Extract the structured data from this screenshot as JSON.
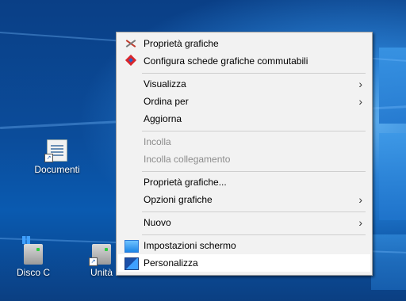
{
  "desktop": {
    "icons": [
      {
        "label": "Documenti"
      },
      {
        "label": "Disco C"
      },
      {
        "label": "Unità"
      }
    ]
  },
  "context_menu": {
    "items": [
      {
        "label": "Proprietà grafiche",
        "icon": "intel-graphics-icon"
      },
      {
        "label": "Configura schede grafiche commutabili",
        "icon": "amd-radeon-icon"
      },
      {
        "label": "Visualizza",
        "submenu": true
      },
      {
        "label": "Ordina per",
        "submenu": true
      },
      {
        "label": "Aggiorna"
      },
      {
        "label": "Incolla",
        "disabled": true
      },
      {
        "label": "Incolla collegamento",
        "disabled": true
      },
      {
        "label": "Proprietà grafiche..."
      },
      {
        "label": "Opzioni grafiche",
        "submenu": true
      },
      {
        "label": "Nuovo",
        "submenu": true
      },
      {
        "label": "Impostazioni schermo",
        "icon": "monitor-icon"
      },
      {
        "label": "Personalizza",
        "icon": "personalize-icon",
        "highlighted": true
      }
    ],
    "submenu_arrow": "›"
  },
  "colors": {
    "menu_bg": "#f2f2f2",
    "disabled_text": "#8c8c8c",
    "desktop_accent": "#0b4c9a"
  }
}
